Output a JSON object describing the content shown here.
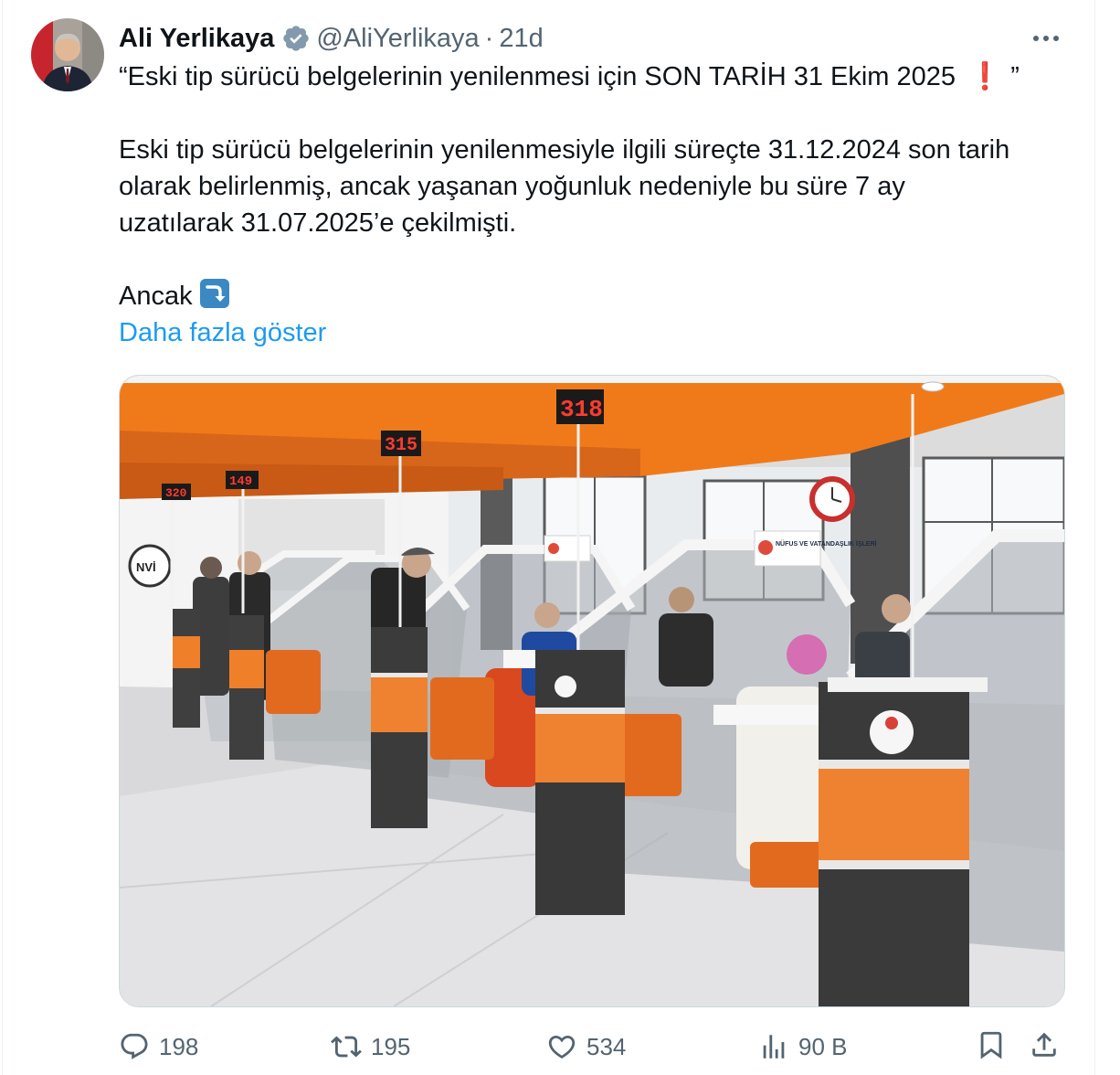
{
  "tweet": {
    "display_name": "Ali Yerlikaya",
    "handle": "@AliYerlikaya",
    "separator": "·",
    "time": "21d",
    "verified_icon": "verified-badge-icon",
    "more_icon": "more-horizontal-icon",
    "text": {
      "line1": "“Eski tip sürücü belgelerinin yenilenmesi için SON TARİH 31 Ekim 2025",
      "line1_emoji": "❗",
      "line1_end": "”",
      "paragraph2": [
        "Eski tip sürücü belgelerinin yenilenmesiyle ilgili süreçte 31.12.2024 son tarih",
        "olarak belirlenmiş, ancak yaşanan yoğunluk nedeniyle bu süre 7 ay",
        "uzatılarak 31.07.2025’e çekilmişti."
      ],
      "paragraph3": "Ancak",
      "paragraph3_emoji_icon": "right-arrow-curving-down-icon"
    },
    "show_more": "Daha fazla göster",
    "photo": {
      "counter_displays": [
        "320",
        "149",
        "315",
        "318"
      ],
      "signs": [
        "NÜFUS VE VATANDAŞLIK İŞLERİ",
        "NVİ"
      ]
    },
    "actions": {
      "replies": "198",
      "reposts": "195",
      "likes": "534",
      "views": "90 B"
    }
  },
  "colors": {
    "link": "#1d9bf0",
    "secondary_text": "#536471",
    "verified": "#829aab",
    "accent_orange": "#f07a1a"
  }
}
